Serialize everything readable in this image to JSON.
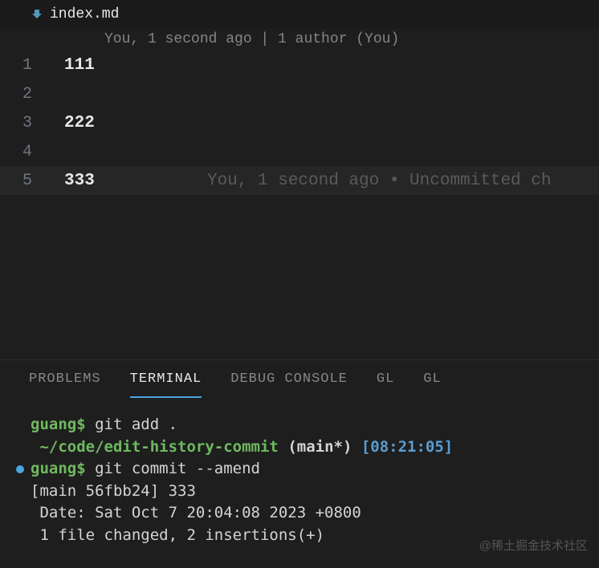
{
  "tab": {
    "filename": "index.md"
  },
  "blame_header": "You, 1 second ago | 1 author (You)",
  "lines": [
    {
      "num": "1",
      "content": "111"
    },
    {
      "num": "2",
      "content": ""
    },
    {
      "num": "3",
      "content": "222"
    },
    {
      "num": "4",
      "content": ""
    },
    {
      "num": "5",
      "content": "333"
    }
  ],
  "inline_blame": "You, 1 second ago • Uncommitted ch",
  "panel": {
    "tabs": {
      "problems": "PROBLEMS",
      "terminal": "TERMINAL",
      "debug": "DEBUG CONSOLE",
      "gl1": "GL",
      "gl2": "GL"
    }
  },
  "terminal": {
    "line1": {
      "user": "guang",
      "dollar": "$ ",
      "cmd": "git add ."
    },
    "line2": {
      "path": "~/code/edit-history-commit",
      "branch": " (main*) ",
      "time": "[08:21:05]"
    },
    "line3": {
      "user": "guang",
      "dollar": "$ ",
      "cmd": "git commit --amend"
    },
    "line4": "[main 56fbb24] 333",
    "line5": " Date: Sat Oct 7 20:04:08 2023 +0800",
    "line6": " 1 file changed, 2 insertions(+)"
  },
  "watermark": "@稀土掘金技术社区"
}
